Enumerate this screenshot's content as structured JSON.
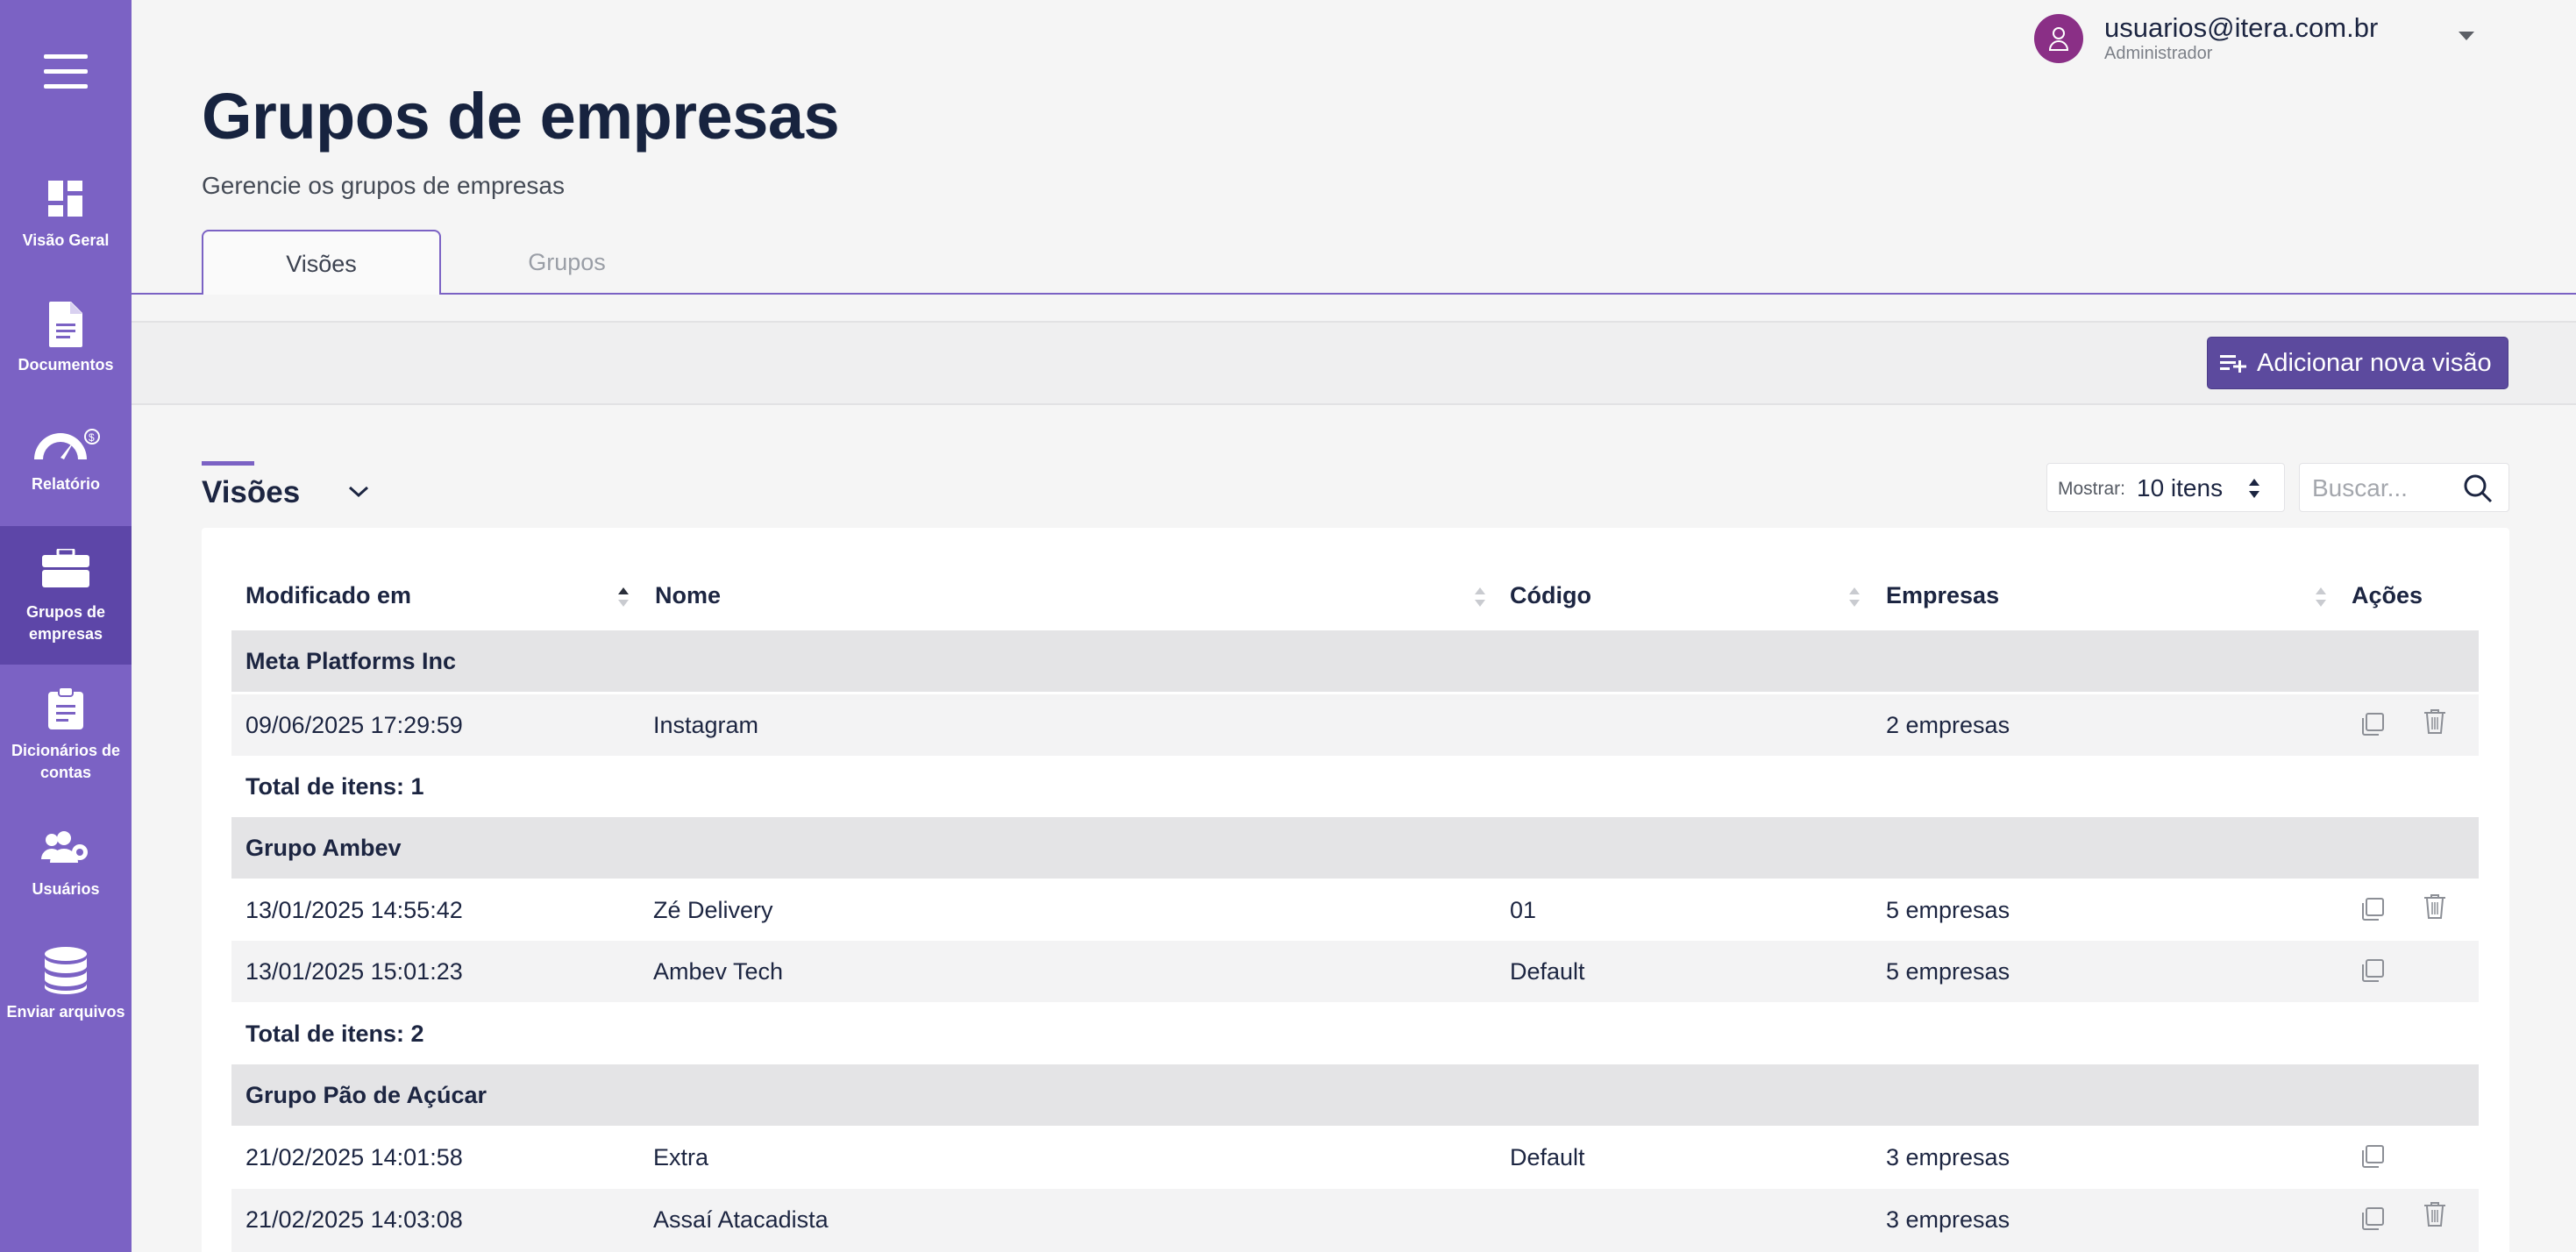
{
  "user": {
    "email": "usuarios@itera.com.br",
    "role": "Administrador"
  },
  "sidebar": {
    "items": [
      {
        "label": "Visão Geral",
        "icon": "dashboard-icon"
      },
      {
        "label": "Documentos",
        "icon": "document-icon"
      },
      {
        "label": "Relatório",
        "icon": "gauge-icon"
      },
      {
        "label": "Grupos de empresas",
        "icon": "briefcase-icon",
        "active": true
      },
      {
        "label": "Dicionários de contas",
        "icon": "clipboard-icon"
      },
      {
        "label": "Usuários",
        "icon": "users-gear-icon"
      },
      {
        "label": "Enviar arquivos",
        "icon": "database-icon"
      }
    ]
  },
  "page": {
    "title": "Grupos de empresas",
    "subtitle": "Gerencie os grupos de empresas"
  },
  "tabs": [
    {
      "label": "Visões",
      "active": true
    },
    {
      "label": "Grupos",
      "active": false
    }
  ],
  "toolbar": {
    "add_label": "Adicionar nova visão"
  },
  "section": {
    "title": "Visões"
  },
  "show": {
    "label": "Mostrar:",
    "value": "10 itens"
  },
  "search": {
    "placeholder": "Buscar..."
  },
  "table": {
    "columns": [
      "Modificado em",
      "Nome",
      "Código",
      "Empresas",
      "Ações"
    ],
    "groups": [
      {
        "name": "Meta Platforms Inc",
        "rows": [
          {
            "date": "09/06/2025 17:29:59",
            "name": "Instagram",
            "code": "",
            "companies": "2 empresas",
            "delete": true
          }
        ],
        "total": "Total de itens: 1"
      },
      {
        "name": "Grupo Ambev",
        "rows": [
          {
            "date": "13/01/2025 14:55:42",
            "name": "Zé Delivery",
            "code": "01",
            "companies": "5 empresas",
            "delete": true
          },
          {
            "date": "13/01/2025 15:01:23",
            "name": "Ambev Tech",
            "code": "Default",
            "companies": "5 empresas",
            "delete": false
          }
        ],
        "total": "Total de itens: 2"
      },
      {
        "name": "Grupo Pão de Açúcar",
        "rows": [
          {
            "date": "21/02/2025 14:01:58",
            "name": "Extra",
            "code": "Default",
            "companies": "3 empresas",
            "delete": false
          },
          {
            "date": "21/02/2025 14:03:08",
            "name": "Assaí Atacadista",
            "code": "",
            "companies": "3 empresas",
            "delete": true
          }
        ]
      }
    ]
  }
}
